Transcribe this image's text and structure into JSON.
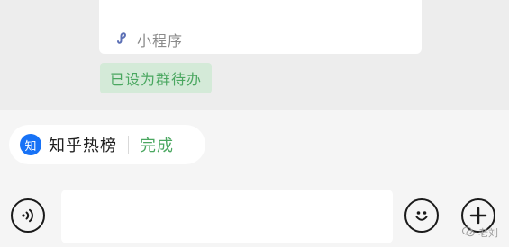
{
  "chat": {
    "mini_program_card": {
      "icon": "mini-program-icon",
      "label": "小程序"
    },
    "todo_tag": "已设为群待办"
  },
  "pinned": {
    "badge": "知",
    "title": "知乎热榜",
    "done_label": "完成"
  },
  "input_bar": {
    "voice_icon": "voice-icon",
    "text_value": "",
    "emoji_icon": "emoji-icon",
    "plus_icon": "plus-icon"
  },
  "watermark": {
    "text": "老刘"
  },
  "colors": {
    "accent_green": "#4aa760",
    "zhihu_blue": "#1772f6"
  }
}
